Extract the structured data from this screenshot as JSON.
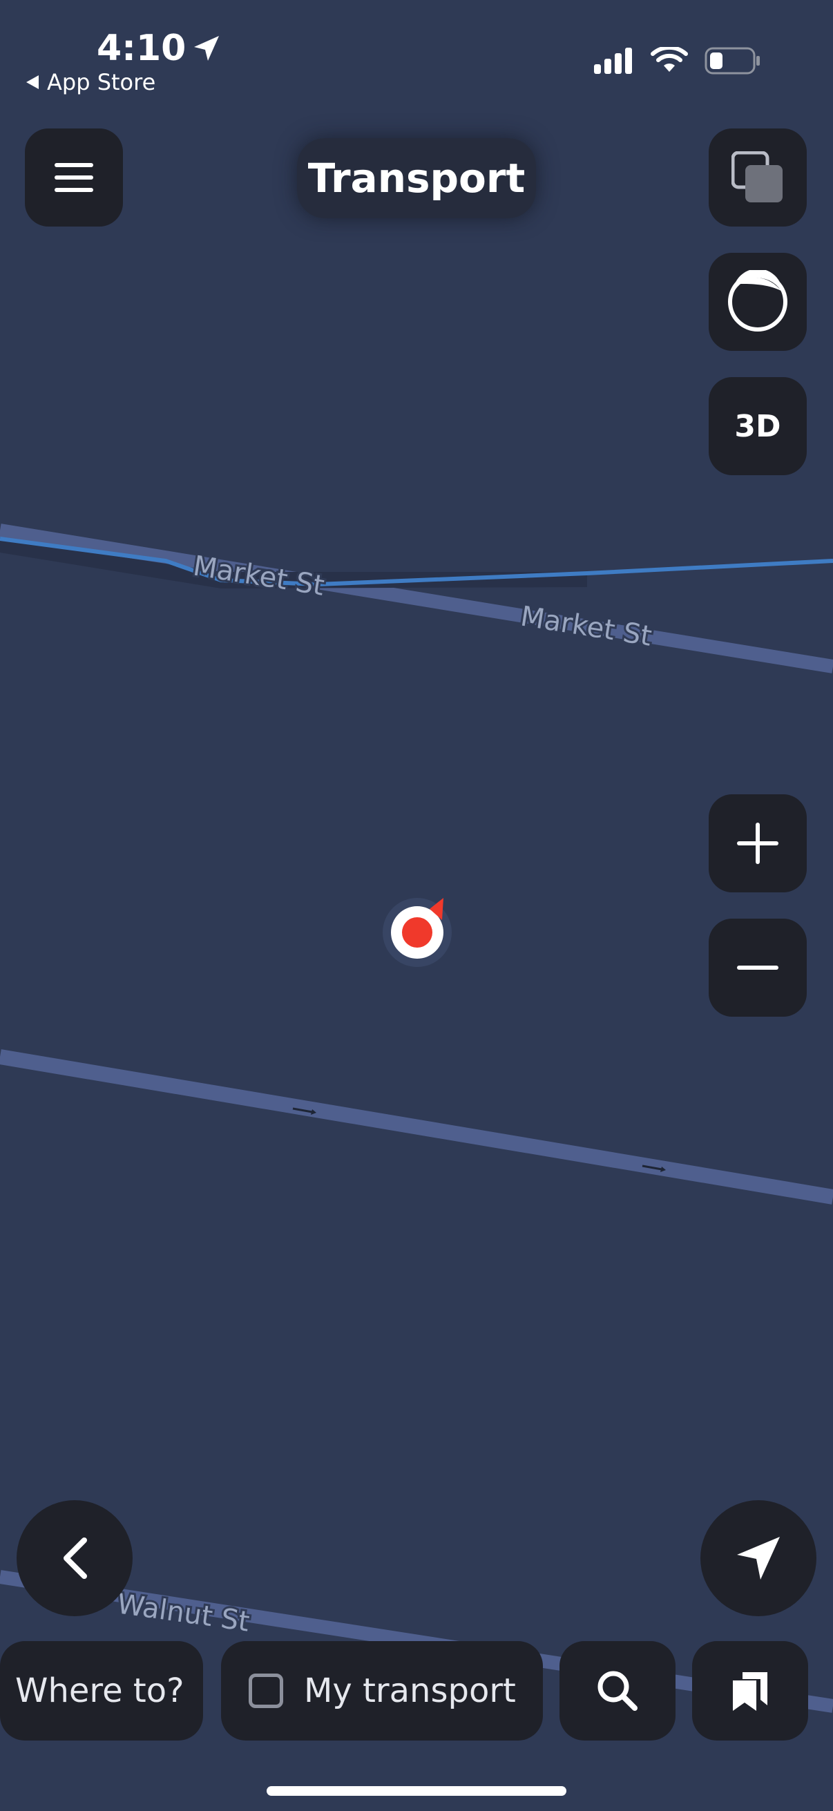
{
  "status_bar": {
    "time": "4:10",
    "back_label": "App Store"
  },
  "header": {
    "title": "Transport"
  },
  "map_controls": {
    "three_d_label": "3D"
  },
  "streets": [
    {
      "name": "Market St"
    },
    {
      "name": "Market St"
    },
    {
      "name": "Walnut St"
    }
  ],
  "bottom_bar": {
    "where_to_label": "Where to?",
    "my_transport_label": "My transport",
    "my_transport_checked": false
  },
  "colors": {
    "map_background": "#2f3a55",
    "road": "#4f5f8e",
    "transit_line": "#3f7cc4",
    "button_background": "#1f2129",
    "location_marker": "#f0392b"
  },
  "icons": {
    "menu": "hamburger-icon",
    "layers": "layers-icon",
    "theme": "moon-circle-icon",
    "zoom_in": "plus-icon",
    "zoom_out": "minus-icon",
    "back": "chevron-left-icon",
    "locate": "navigation-arrow-icon",
    "search": "search-icon",
    "bookmarks": "bookmarks-icon"
  }
}
